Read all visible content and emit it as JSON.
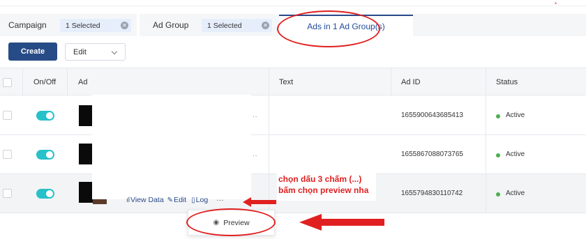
{
  "tabs": {
    "campaign": {
      "label": "Campaign",
      "chip": "1 Selected"
    },
    "ad_group": {
      "label": "Ad Group",
      "chip": "1 Selected"
    },
    "ads": {
      "label": "Ads in 1 Ad Group(s)"
    }
  },
  "toolbar": {
    "create_label": "Create",
    "edit_label": "Edit"
  },
  "table": {
    "headers": {
      "onoff": "On/Off",
      "ad": "Ad",
      "text": "Text",
      "ad_id": "Ad ID",
      "status": "Status"
    },
    "rows": [
      {
        "ad_id": "1655900643685413",
        "status": "Active",
        "enabled": true
      },
      {
        "ad_id": "1655867088073765",
        "status": "Active",
        "enabled": true
      },
      {
        "ad_id": "1655794830110742",
        "status": "Active",
        "enabled": true
      }
    ]
  },
  "row_actions": {
    "view_data": "View Data",
    "edit": "Edit",
    "log": "Log",
    "more": "···"
  },
  "popover": {
    "preview": "Preview"
  },
  "annotation": {
    "line1": "chọn dấu 3 chấm (...)",
    "line2": "bấm chọn preview nha"
  },
  "colors": {
    "accent": "#274b86",
    "toggle_on": "#26c1c9",
    "status_active": "#4caf50",
    "annotation": "#e02020"
  }
}
